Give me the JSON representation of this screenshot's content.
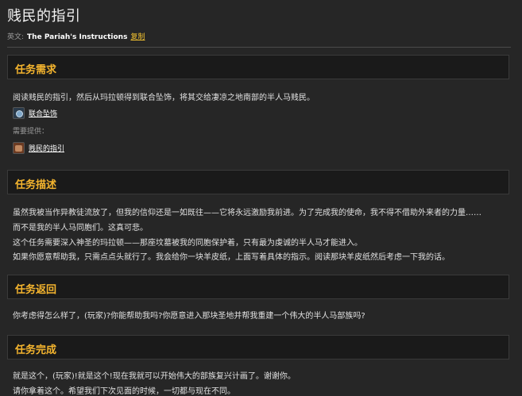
{
  "title": "贱民的指引",
  "english": {
    "label": "英文:",
    "name": "The Pariah's Instructions",
    "copy": "复制"
  },
  "sections": {
    "requirements": {
      "heading": "任务需求",
      "text": "阅读贱民的指引，然后从玛拉顿得到联合坠饰，将其交给凄凉之地南部的半人马贱民。",
      "item": "联合坠饰",
      "provided_label": "需要提供：",
      "provided_item": "贱民的指引"
    },
    "description": {
      "heading": "任务描述",
      "lines": [
        "虽然我被当作异教徒流放了，但我的信仰还是一如既往——它将永远激励我前进。为了完成我的使命，我不得不借助外来者的力量……",
        "而不是我的半人马同胞们。这真可悲。",
        "这个任务需要深入神圣的玛拉顿——那座坟墓被我的同胞保护着，只有最为虔诚的半人马才能进入。",
        "如果你愿意帮助我，只需点点头就行了。我会给你一块羊皮纸，上面写着具体的指示。阅读那块羊皮纸然后考虑一下我的话。"
      ]
    },
    "return": {
      "heading": "任务返回",
      "text": "你考虑得怎么样了，(玩家)?你能帮助我吗?你愿意进入那块圣地并帮我重建一个伟大的半人马部族吗?"
    },
    "complete": {
      "heading": "任务完成",
      "lines": [
        "就是这个，(玩家)!就是这个!现在我就可以开始伟大的部族复兴计画了。谢谢你。",
        "请你拿着这个。希望我们下次见面的时候，一切都与现在不同。"
      ]
    }
  },
  "colors": {
    "heading": "#f5b52e",
    "copy_link": "#f0c030",
    "background": "#262626"
  }
}
